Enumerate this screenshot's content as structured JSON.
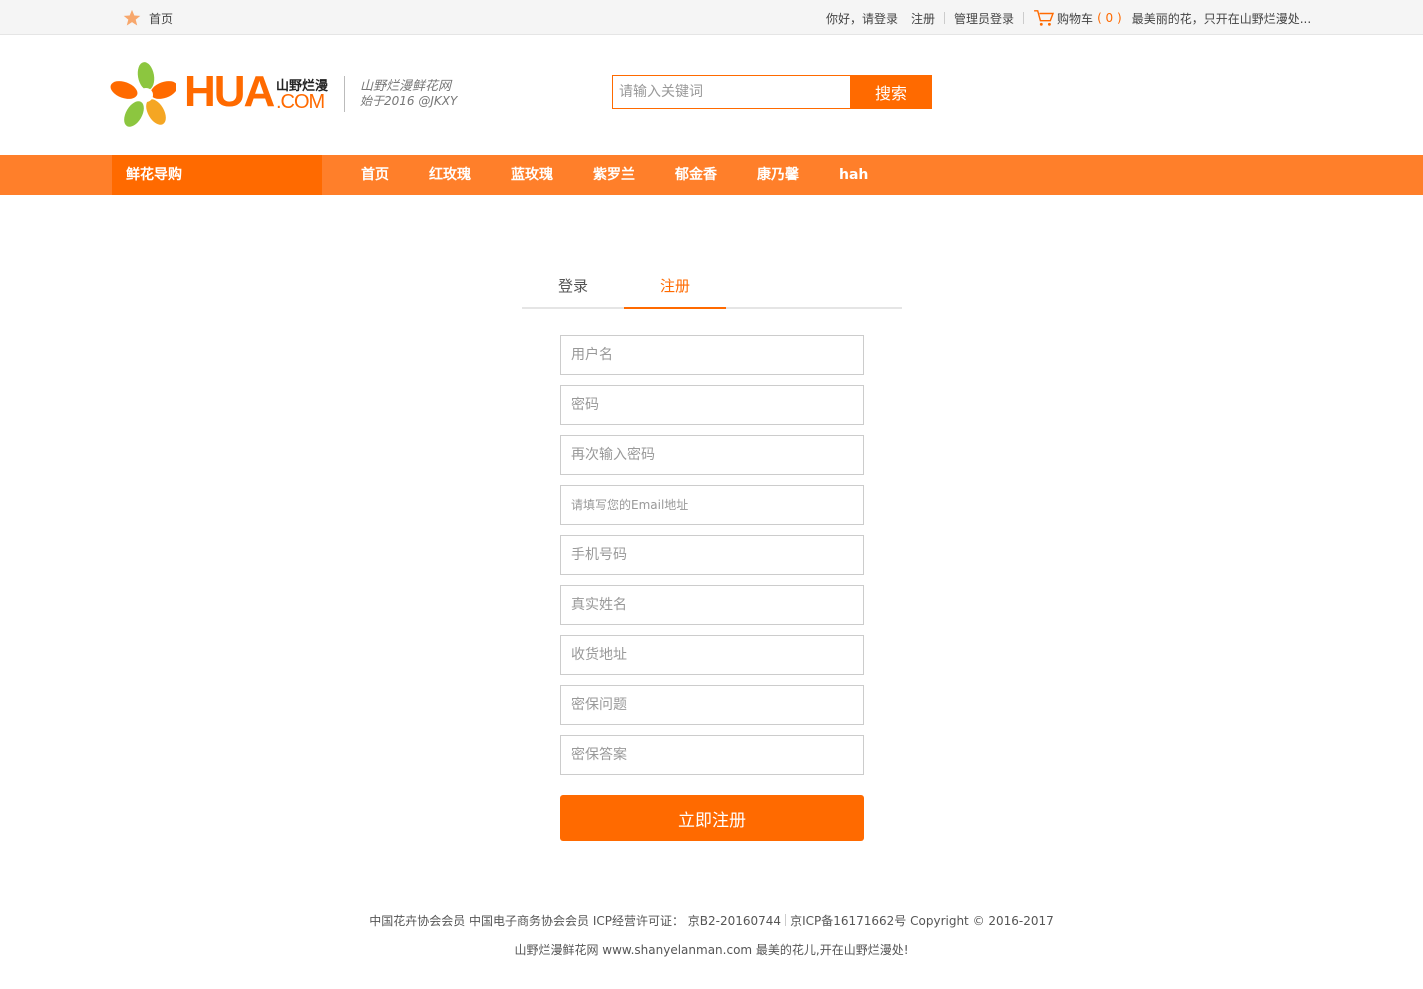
{
  "topbar": {
    "home": "首页",
    "greeting": "你好，请登录",
    "register": "注册",
    "admin_login": "管理员登录",
    "cart": "购物车",
    "cart_count": "( 0 )",
    "slogan": "最美丽的花，只开在山野烂漫处..."
  },
  "header": {
    "logo_text": "HUA",
    "logo_com": ".COM",
    "logo_cn": "山野烂漫",
    "logo_sub1": "山野烂漫鲜花网",
    "logo_sub2": "始于2016 @JKXY",
    "search_placeholder": "请输入关键词",
    "search_button": "搜索"
  },
  "nav": {
    "guide": "鲜花导购",
    "items": [
      "首页",
      "红玫瑰",
      "蓝玫瑰",
      "紫罗兰",
      "郁金香",
      "康乃馨",
      "hah"
    ]
  },
  "tabs": {
    "login": "登录",
    "register": "注册"
  },
  "form": {
    "username": "用户名",
    "password": "密码",
    "password_again": "再次输入密码",
    "email": "请填写您的Email地址",
    "phone": "手机号码",
    "real_name": "真实姓名",
    "address": "收货地址",
    "question": "密保问题",
    "answer": "密保答案",
    "submit": "立即注册"
  },
  "footer": {
    "line1_a": "中国花卉协会会员 中国电子商务协会会员 ICP经营许可证：  京B2-20160744",
    "line1_b": "京ICP备16171662号 Copyright © 2016-2017",
    "line2": "山野烂漫鲜花网 www.shanyelanman.com 最美的花儿,开在山野烂漫处!"
  },
  "colors": {
    "accent": "#ff6a00",
    "nav_bg": "#ff7f2a"
  }
}
